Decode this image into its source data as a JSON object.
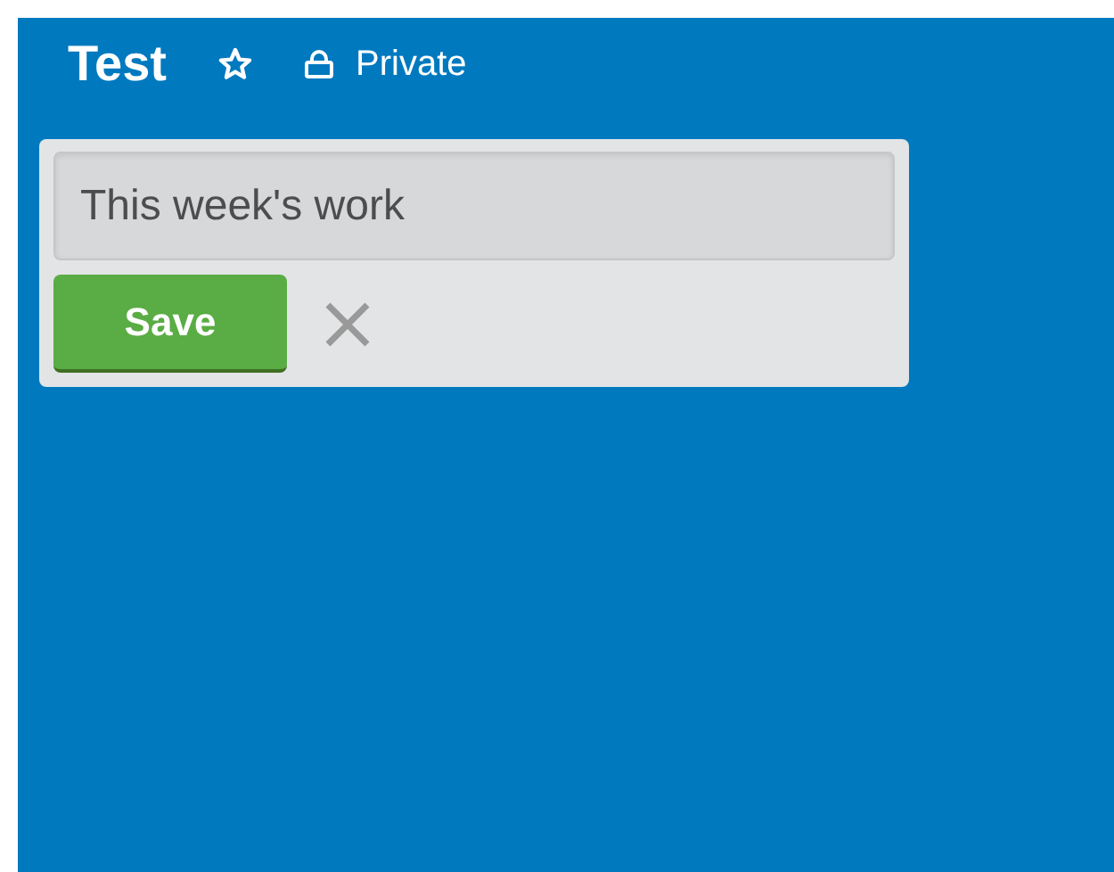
{
  "board": {
    "title": "Test",
    "starred": false,
    "visibility": "Private"
  },
  "add_list_form": {
    "value": "This week's work",
    "buttons": [
      "Save"
    ]
  }
}
